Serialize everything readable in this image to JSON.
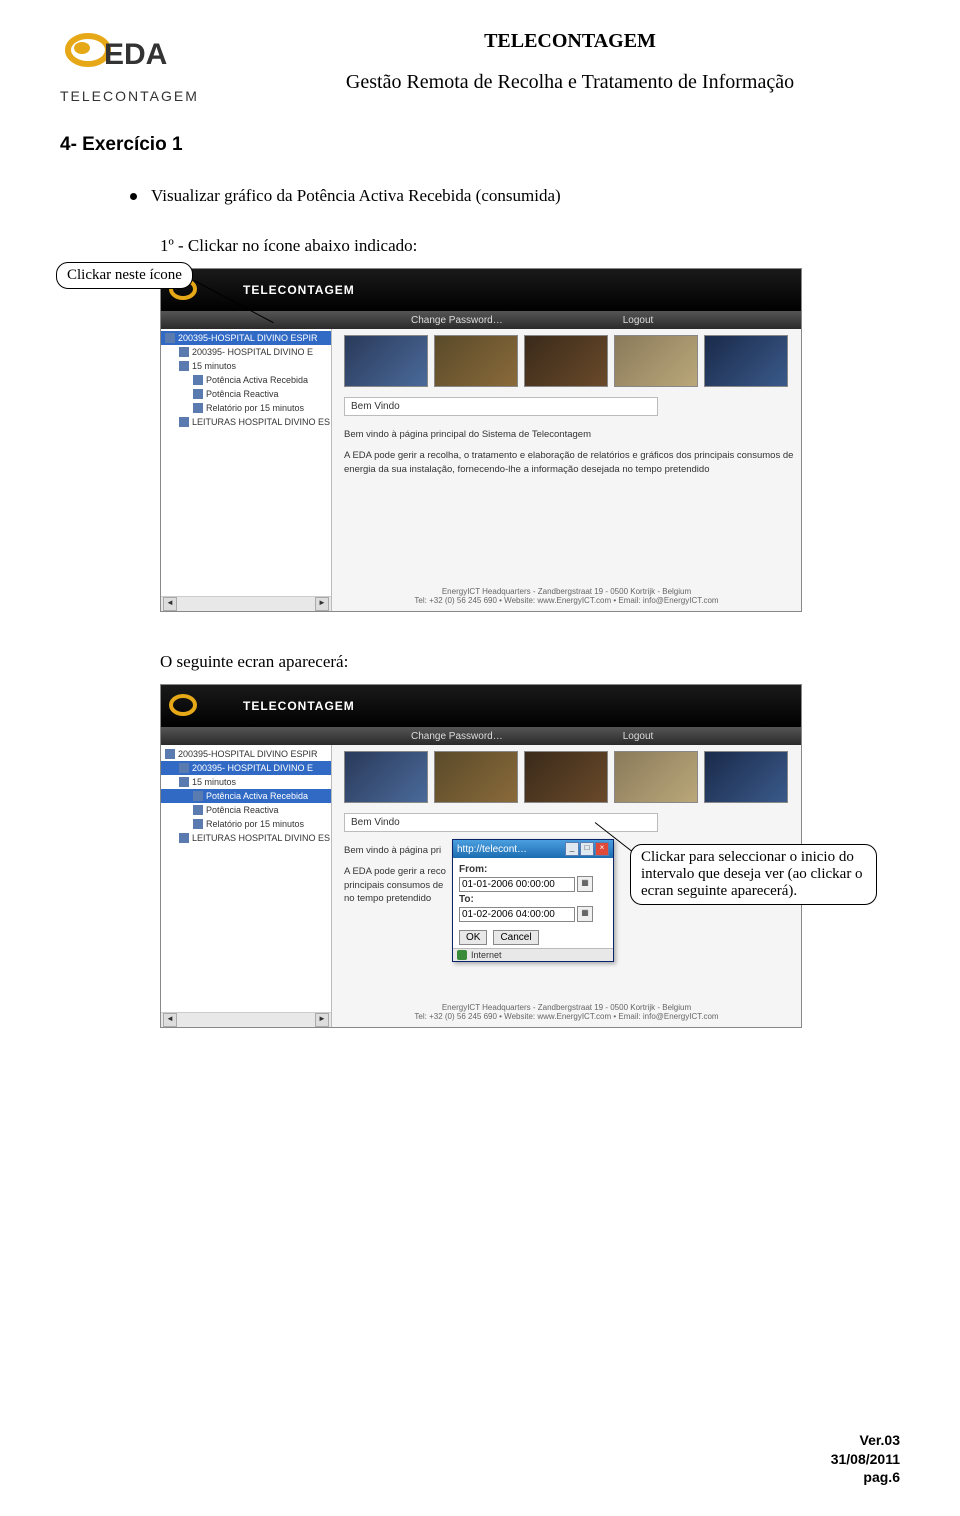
{
  "header": {
    "line1": "TELECONTAGEM",
    "line2": "Gestão Remota de Recolha e Tratamento de Informação",
    "logo_text": "EDA",
    "logo_sub": "TELECONTAGEM"
  },
  "section_heading": "4- Exercício 1",
  "bullet_text": "Visualizar gráfico da Potência Activa Recebida (consumida)",
  "step1": "1º - Clickar no ícone abaixo indicado:",
  "callout1": "Clickar neste ícone",
  "caption_mid": "O seguinte ecran aparecerá:",
  "callout2": "Clickar para seleccionar o inicio do intervalo que deseja ver (ao clickar o ecran seguinte aparecerá).",
  "app": {
    "brand": "TELECONTAGEM",
    "menu_change_pw": "Change Password…",
    "menu_logout": "Logout",
    "tree": [
      {
        "label": "200395-HOSPITAL DIVINO ESPIR",
        "lvl": 1,
        "sel_a": true,
        "sel_b": false
      },
      {
        "label": "200395- HOSPITAL DIVINO E",
        "lvl": 2,
        "sel_a": false,
        "sel_b": true
      },
      {
        "label": "15 minutos",
        "lvl": 2,
        "sel_a": false,
        "sel_b": false
      },
      {
        "label": "Potência Activa  Recebida",
        "lvl": 3,
        "sel_a": false,
        "sel_b": true,
        "hl_b": true
      },
      {
        "label": "Potência Reactiva",
        "lvl": 3,
        "sel_a": false,
        "sel_b": false
      },
      {
        "label": "Relatório por 15 minutos",
        "lvl": 3,
        "sel_a": false,
        "sel_b": false
      },
      {
        "label": "LEITURAS HOSPITAL DIVINO ES",
        "lvl": 2,
        "sel_a": false,
        "sel_b": false
      }
    ],
    "welcome_title": "Bem Vindo",
    "welcome_line1": "Bem vindo à página principal do Sistema de Telecontagem",
    "welcome_line2": "A EDA pode gerir a recolha, o tratamento e elaboração de relatórios e gráficos dos principais consumos de energia da sua instalação, fornecendo-lhe a informação desejada no tempo pretendido",
    "footer1": "EnergyICT Headquarters - Zandbergstraat 19 - 0500 Kortrijk - Belgium",
    "footer2": "Tel: +32 (0) 56 245 690 • Website: www.EnergyICT.com • Email: info@EnergyICT.com"
  },
  "dialog": {
    "title": "http://telecont…",
    "from_label": "From:",
    "from_value": "01-01-2006 00:00:00",
    "to_label": "To:",
    "to_value": "01-02-2006 04:00:00",
    "ok": "OK",
    "cancel": "Cancel",
    "status": "Internet"
  },
  "footer": {
    "ver": "Ver.03",
    "date": "31/08/2011",
    "page": "pag.6"
  }
}
